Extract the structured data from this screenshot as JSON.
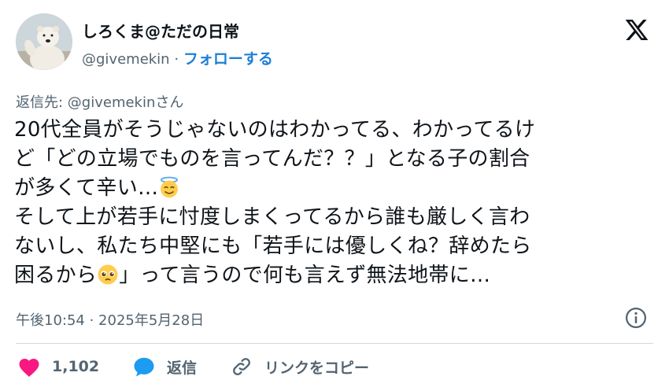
{
  "author": {
    "name": "しろくま@ただの日常",
    "handle": "@givemekin",
    "separator": "·",
    "follow_label": "フォローする"
  },
  "tweet": {
    "reply_to": "返信先: @givemekinさん",
    "lines": [
      "20代全員がそうじゃないのはわかってる、わかってるけ",
      "ど「どの立場でものを言ってんだ？？」となる子の割合",
      "が多くて辛い…",
      "そして上が若手に忖度しまくってるから誰も厳しく言わ",
      "ないし、私たち中堅にも「若手には優しくね？辞めたら",
      "困るから",
      "」って言うので何も言えず無法地帯に…"
    ],
    "emojis": [
      "smiling-face-with-halo-icon",
      "pleading-face-icon"
    ],
    "timestamp": "午後10:54 · 2025年5月28日"
  },
  "actions": {
    "like_count": "1,102",
    "reply_label": "返信",
    "copy_link_label": "リンクをコピー"
  },
  "colors": {
    "text": "#0f1419",
    "secondary": "#536471",
    "follow": "#1d7fd6",
    "like": "#f91880",
    "reply": "#1d9bf0",
    "divider": "#cfd9de"
  }
}
